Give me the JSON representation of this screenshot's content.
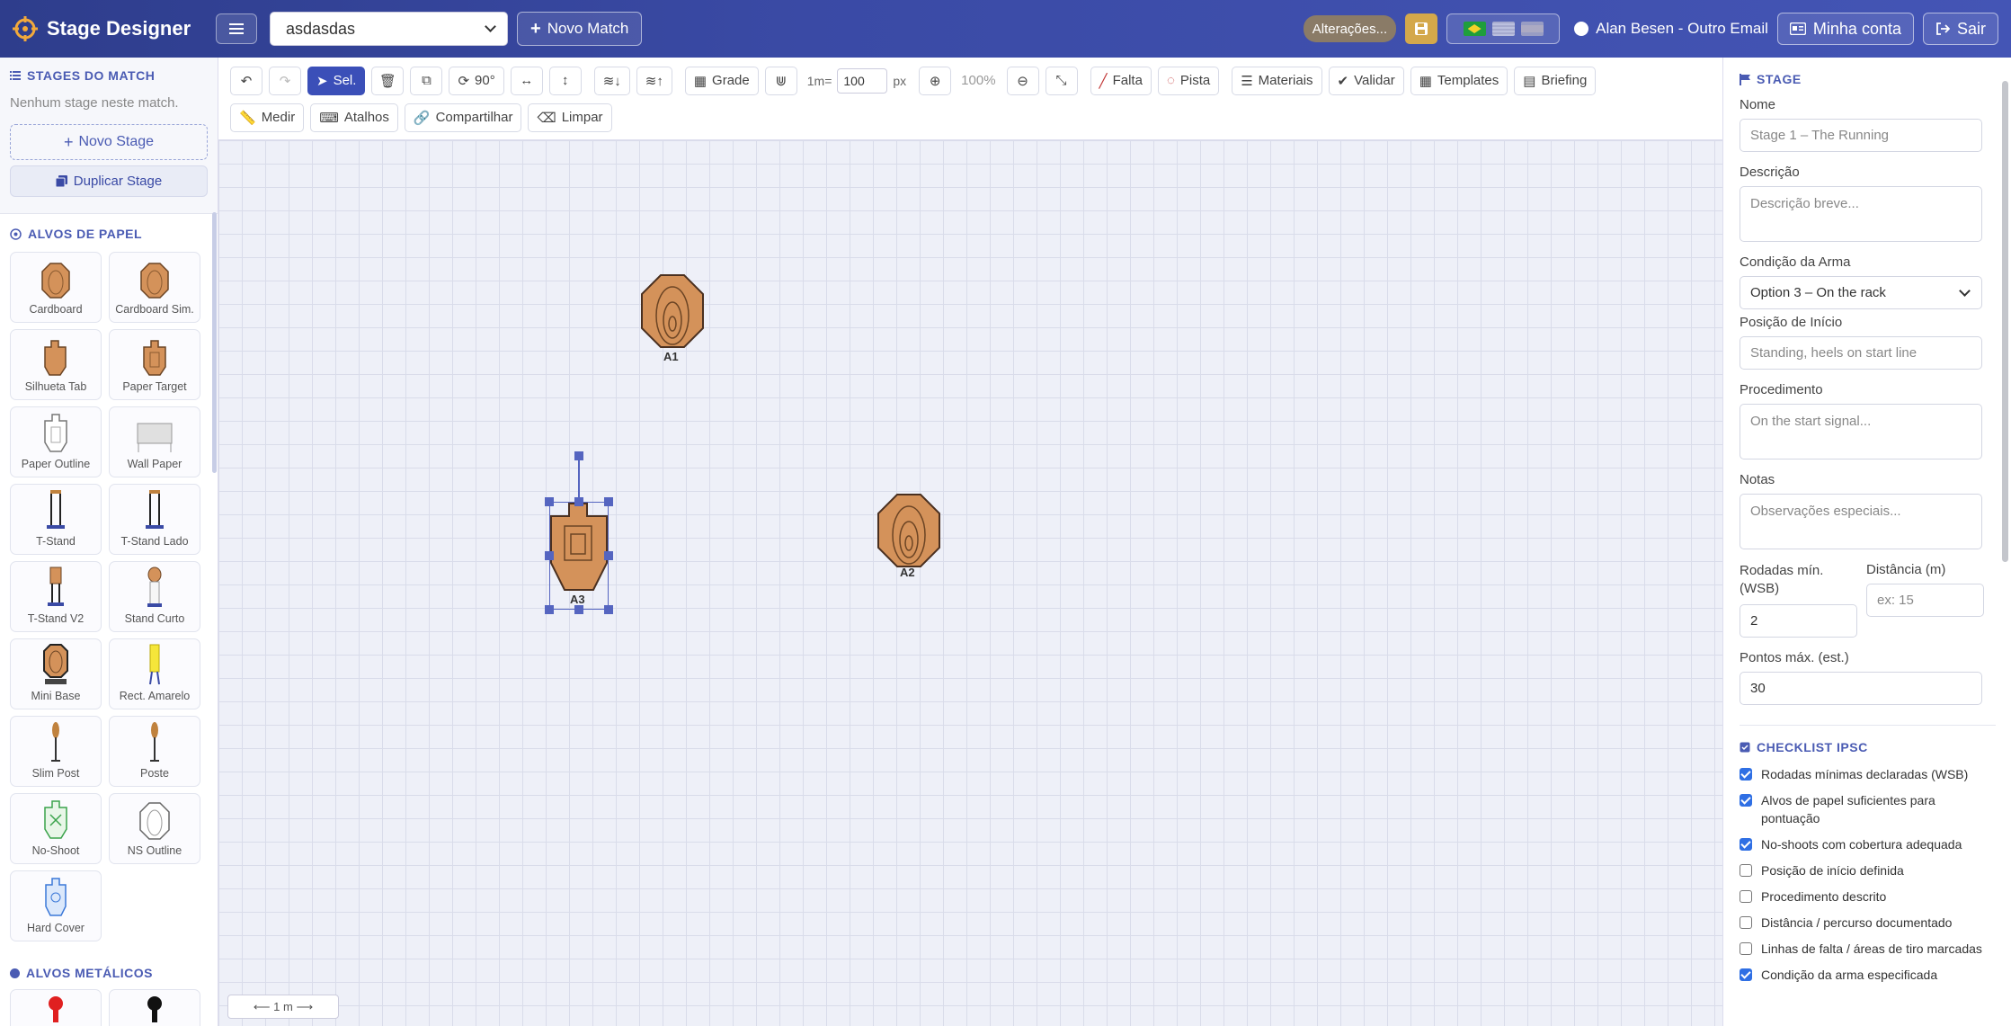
{
  "header": {
    "app_title": "Stage Designer",
    "match_selected": "asdasdas",
    "new_match_label": "Novo Match",
    "changes_label": "Alterações...",
    "user_label": "Alan Besen - Outro Email",
    "account_label": "Minha conta",
    "logout_label": "Sair",
    "brand_color": "#3a4aa5"
  },
  "sidebar": {
    "stages_title": "STAGES DO MATCH",
    "stages_empty": "Nenhum stage neste match.",
    "new_stage_label": "Novo Stage",
    "duplicate_stage_label": "Duplicar Stage",
    "paper_title": "ALVOS DE PAPEL",
    "paper_items": [
      {
        "label": "Cardboard",
        "icon": "cardboard-icon"
      },
      {
        "label": "Cardboard Sim.",
        "icon": "cardboard-sim-icon"
      },
      {
        "label": "Silhueta Tab",
        "icon": "silhueta-tab-icon"
      },
      {
        "label": "Paper Target",
        "icon": "paper-target-icon"
      },
      {
        "label": "Paper Outline",
        "icon": "paper-outline-icon"
      },
      {
        "label": "Wall Paper",
        "icon": "wall-paper-icon"
      },
      {
        "label": "T-Stand",
        "icon": "t-stand-icon"
      },
      {
        "label": "T-Stand Lado",
        "icon": "t-stand-lado-icon"
      },
      {
        "label": "T-Stand V2",
        "icon": "t-stand-v2-icon"
      },
      {
        "label": "Stand Curto",
        "icon": "stand-curto-icon"
      },
      {
        "label": "Mini Base",
        "icon": "mini-base-icon"
      },
      {
        "label": "Rect. Amarelo",
        "icon": "rect-amarelo-icon"
      },
      {
        "label": "Slim Post",
        "icon": "slim-post-icon"
      },
      {
        "label": "Poste",
        "icon": "poste-icon"
      },
      {
        "label": "No-Shoot",
        "icon": "no-shoot-icon"
      },
      {
        "label": "NS Outline",
        "icon": "ns-outline-icon"
      },
      {
        "label": "Hard Cover",
        "icon": "hard-cover-icon"
      }
    ],
    "metal_title": "ALVOS METÁLICOS"
  },
  "toolbar": {
    "select_label": "Sel.",
    "rotate_label": "90°",
    "grid_label": "Grade",
    "scale_prefix": "1m=",
    "scale_value": "100",
    "scale_unit": "px",
    "zoom_value": "100%",
    "fault_label": "Falta",
    "track_label": "Pista",
    "materials_label": "Materiais",
    "validate_label": "Validar",
    "templates_label": "Templates",
    "briefing_label": "Briefing",
    "measure_label": "Medir",
    "shortcuts_label": "Atalhos",
    "share_label": "Compartilhar",
    "clear_label": "Limpar"
  },
  "canvas": {
    "targets": [
      {
        "label": "A1"
      },
      {
        "label": "A2"
      },
      {
        "label": "A3"
      }
    ],
    "scale_bar": "⟵ 1 m ⟶"
  },
  "panel": {
    "title": "STAGE",
    "name_label": "Nome",
    "name_placeholder": "Stage 1 – The Running",
    "desc_label": "Descrição",
    "desc_placeholder": "Descrição breve...",
    "weapon_label": "Condição da Arma",
    "weapon_value": "Option 3 – On the rack",
    "start_label": "Posição de Início",
    "start_placeholder": "Standing, heels on start line",
    "procedure_label": "Procedimento",
    "procedure_placeholder": "On the start signal...",
    "notes_label": "Notas",
    "notes_placeholder": "Observações especiais...",
    "min_rounds_label": "Rodadas mín. (WSB)",
    "min_rounds_value": "2",
    "distance_label": "Distância (m)",
    "distance_placeholder": "ex: 15",
    "max_points_label": "Pontos máx. (est.)",
    "max_points_value": "30",
    "checklist_title": "CHECKLIST IPSC",
    "checklist": [
      {
        "label": "Rodadas mínimas declaradas (WSB)",
        "checked": true
      },
      {
        "label": "Alvos de papel suficientes para pontuação",
        "checked": true
      },
      {
        "label": "No-shoots com cobertura adequada",
        "checked": true
      },
      {
        "label": "Posição de início definida",
        "checked": false
      },
      {
        "label": "Procedimento descrito",
        "checked": false
      },
      {
        "label": "Distância / percurso documentado",
        "checked": false
      },
      {
        "label": "Linhas de falta / áreas de tiro marcadas",
        "checked": false
      },
      {
        "label": "Condição da arma especificada",
        "checked": true
      }
    ]
  }
}
